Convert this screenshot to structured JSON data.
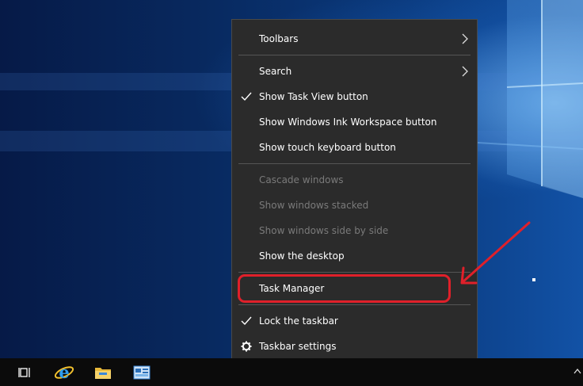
{
  "context_menu": {
    "items": [
      {
        "label": "Toolbars",
        "submenu": true,
        "checked": false,
        "enabled": true
      },
      {
        "label": "Search",
        "submenu": true,
        "checked": false,
        "enabled": true
      },
      {
        "label": "Show Task View button",
        "submenu": false,
        "checked": true,
        "enabled": true
      },
      {
        "label": "Show Windows Ink Workspace button",
        "submenu": false,
        "checked": false,
        "enabled": true
      },
      {
        "label": "Show touch keyboard button",
        "submenu": false,
        "checked": false,
        "enabled": true
      },
      {
        "label": "Cascade windows",
        "submenu": false,
        "checked": false,
        "enabled": false
      },
      {
        "label": "Show windows stacked",
        "submenu": false,
        "checked": false,
        "enabled": false
      },
      {
        "label": "Show windows side by side",
        "submenu": false,
        "checked": false,
        "enabled": false
      },
      {
        "label": "Show the desktop",
        "submenu": false,
        "checked": false,
        "enabled": true
      },
      {
        "label": "Task Manager",
        "submenu": false,
        "checked": false,
        "enabled": true
      },
      {
        "label": "Lock the taskbar",
        "submenu": false,
        "checked": true,
        "enabled": true
      },
      {
        "label": "Taskbar settings",
        "submenu": false,
        "checked": false,
        "enabled": true,
        "icon": "gear-icon"
      }
    ]
  },
  "taskbar": {
    "buttons": [
      {
        "name": "task-view-icon"
      },
      {
        "name": "internet-explorer-icon"
      },
      {
        "name": "file-explorer-icon"
      },
      {
        "name": "server-manager-icon"
      }
    ]
  },
  "annotation": {
    "highlight_color": "#e0202a",
    "target": "Task Manager"
  },
  "colors": {
    "menu_bg": "#2b2b2b",
    "menu_text": "#ffffff",
    "disabled_text": "#7a7a7a",
    "taskbar_bg": "#0b0b0b"
  }
}
